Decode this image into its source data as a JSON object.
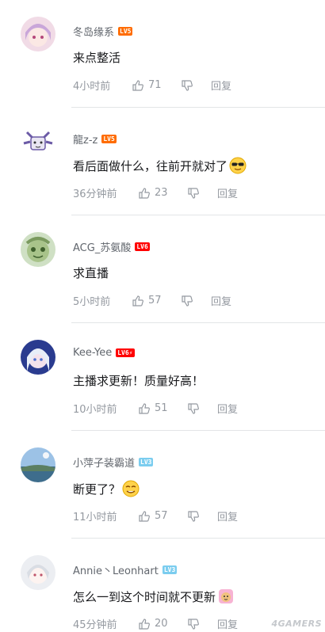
{
  "comments": [
    {
      "username": "冬岛缘系",
      "level": "LV5",
      "text": "来点整活",
      "time": "4小时前",
      "likes": "71",
      "reply": "回复",
      "emoji": ""
    },
    {
      "username": "龍z-z",
      "level": "LV5",
      "text": "看后面做什么，往前开就对了",
      "time": "36分钟前",
      "likes": "23",
      "reply": "回复",
      "emoji": "sunglasses-emoji"
    },
    {
      "username": "ACG_苏氨酸",
      "level": "LV6",
      "text": "求直播",
      "time": "5小时前",
      "likes": "57",
      "reply": "回复",
      "emoji": ""
    },
    {
      "username": "Kee-Yee",
      "level": "LV6⚡",
      "text": "主播求更新！质量好高！",
      "time": "10小时前",
      "likes": "51",
      "reply": "回复",
      "emoji": ""
    },
    {
      "username": "小萍子装霸道",
      "level": "LV3",
      "text": "断更了？",
      "time": "11小时前",
      "likes": "57",
      "reply": "回复",
      "emoji": "smirk-emoji"
    },
    {
      "username": "Annie丶Leonhart",
      "level": "LV3",
      "text": "怎么一到这个时间就不更新",
      "time": "45分钟前",
      "likes": "20",
      "reply": "回复",
      "emoji": "doge-emoji"
    }
  ],
  "watermark": "4GAMERS"
}
